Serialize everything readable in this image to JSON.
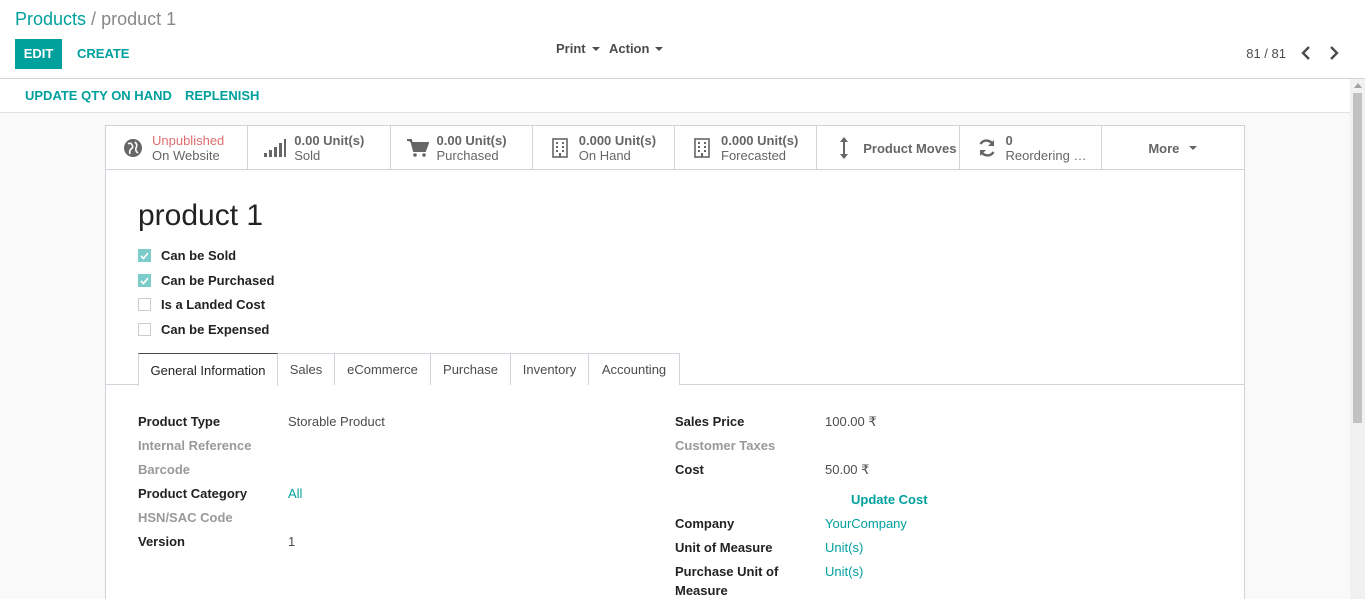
{
  "breadcrumb": {
    "parent": "Products",
    "separator": "/",
    "current": "product 1"
  },
  "toolbar": {
    "edit_label": "EDIT",
    "create_label": "CREATE",
    "print_label": "Print",
    "action_label": "Action"
  },
  "pager": {
    "value": "81 / 81"
  },
  "statusbar": {
    "update_qty_label": "UPDATE QTY ON HAND",
    "replenish_label": "REPLENISH"
  },
  "smart_buttons": [
    {
      "icon": "globe-icon",
      "value": "Unpublished",
      "label": "On Website"
    },
    {
      "icon": "signal-icon",
      "value": "0.00 Unit(s)",
      "label": "Sold"
    },
    {
      "icon": "cart-icon",
      "value": "0.00 Unit(s)",
      "label": "Purchased"
    },
    {
      "icon": "building-icon",
      "value": "0.000 Unit(s)",
      "label": "On Hand"
    },
    {
      "icon": "building-icon",
      "value": "0.000 Unit(s)",
      "label": "Forecasted"
    },
    {
      "icon": "arrows-v-icon",
      "value": "",
      "label": "Product Moves"
    },
    {
      "icon": "refresh-icon",
      "value": "0",
      "label": "Reordering Rules"
    },
    {
      "icon": "",
      "value": "",
      "label": "More"
    }
  ],
  "product": {
    "name": "product 1",
    "checkboxes": [
      {
        "label": "Can be Sold",
        "checked": true
      },
      {
        "label": "Can be Purchased",
        "checked": true
      },
      {
        "label": "Is a Landed Cost",
        "checked": false
      },
      {
        "label": "Can be Expensed",
        "checked": false
      }
    ]
  },
  "tabs": [
    "General Information",
    "Sales",
    "eCommerce",
    "Purchase",
    "Inventory",
    "Accounting"
  ],
  "left_fields": [
    {
      "label": "Product Type",
      "value": "Storable Product"
    },
    {
      "label": "Internal Reference",
      "value": ""
    },
    {
      "label": "Barcode",
      "value": ""
    },
    {
      "label": "Product Category",
      "value": "All"
    },
    {
      "label": "HSN/SAC Code",
      "value": ""
    },
    {
      "label": "Version",
      "value": "1"
    }
  ],
  "right_fields": {
    "sales_price_label": "Sales Price",
    "sales_price": "100.00 ₹",
    "customer_taxes_label": "Customer Taxes",
    "cost_label": "Cost",
    "cost": "50.00 ₹",
    "update_cost_label": "Update Cost",
    "company_label": "Company",
    "company": "YourCompany",
    "uom_label": "Unit of Measure",
    "uom": "Unit(s)",
    "purchase_uom_label_1": "Purchase Unit of",
    "purchase_uom_label_2": "Measure",
    "purchase_uom": "Unit(s)"
  },
  "colors": {
    "accent": "#00a09d",
    "unpublished": "#e06e6e",
    "checkbox": "#7ccccc"
  }
}
